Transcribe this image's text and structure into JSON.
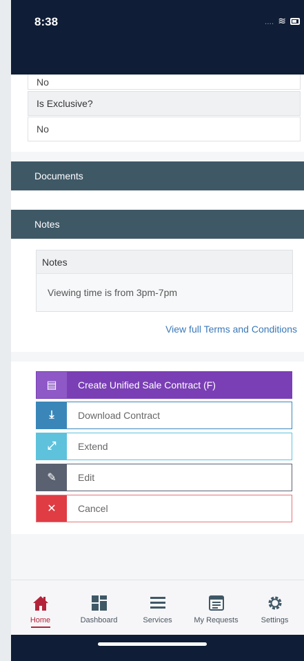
{
  "status": {
    "time": "8:38",
    "dots": "....",
    "wifi": "≋"
  },
  "details": {
    "prev_value": "No",
    "exclusive_label": "Is Exclusive?",
    "exclusive_value": "No"
  },
  "sections": {
    "documents": "Documents",
    "notes": "Notes"
  },
  "notes": {
    "heading": "Notes",
    "text": "Viewing time is from 3pm-7pm"
  },
  "terms_link": "View full Terms and Conditions",
  "actions": [
    {
      "label": "Create Unified Sale Contract (F)",
      "icon": "document-icon",
      "glyph": "▤"
    },
    {
      "label": "Download Contract",
      "icon": "download-icon",
      "glyph": "⤓"
    },
    {
      "label": "Extend",
      "icon": "expand-icon",
      "glyph": "⤢"
    },
    {
      "label": "Edit",
      "icon": "edit-icon",
      "glyph": "✎"
    },
    {
      "label": "Cancel",
      "icon": "close-icon",
      "glyph": "✕"
    }
  ],
  "tabs": [
    {
      "label": "Home",
      "icon": "home-icon",
      "active": true
    },
    {
      "label": "Dashboard",
      "icon": "dashboard-icon"
    },
    {
      "label": "Services",
      "icon": "menu-icon"
    },
    {
      "label": "My Requests",
      "icon": "requests-icon"
    },
    {
      "label": "Settings",
      "icon": "gear-icon"
    }
  ],
  "colors": {
    "header": "#0f1d36",
    "section_bar": "#3f5866",
    "create": "#7a3fb5",
    "download": "#3a86b9",
    "extend": "#5ec2dc",
    "edit": "#5a6170",
    "cancel": "#e03c44",
    "active_tab": "#b3243a",
    "link": "#3a78b8"
  }
}
